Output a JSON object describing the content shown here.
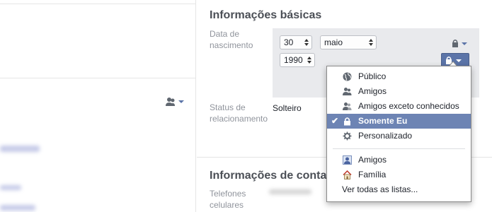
{
  "basic_info": {
    "title": "Informações básicas",
    "birth_label": "Data de nascimento",
    "birth_day": "30",
    "birth_month": "maio",
    "birth_year": "1990",
    "relationship_label": "Status de relacionamento",
    "relationship_value": "Solteiro"
  },
  "contact_info": {
    "title": "Informações de conta",
    "phones_label": "Telefones celulares"
  },
  "audience_menu": {
    "items": [
      {
        "label": "Público",
        "icon": "globe-icon"
      },
      {
        "label": "Amigos",
        "icon": "friends-icon"
      },
      {
        "label": "Amigos exceto conhecidos",
        "icon": "friends-except-icon"
      },
      {
        "label": "Somente Eu",
        "icon": "lock-icon",
        "selected": true
      },
      {
        "label": "Personalizado",
        "icon": "gear-icon"
      }
    ],
    "lists": [
      {
        "label": "Amigos",
        "icon": "friends-list-icon"
      },
      {
        "label": "Família",
        "icon": "house-icon"
      }
    ],
    "see_all": "Ver todas as listas..."
  },
  "colors": {
    "selected_bg": "#6d84b4",
    "button_bg": "#5b74a8",
    "panel_bg": "#e9eaed"
  }
}
